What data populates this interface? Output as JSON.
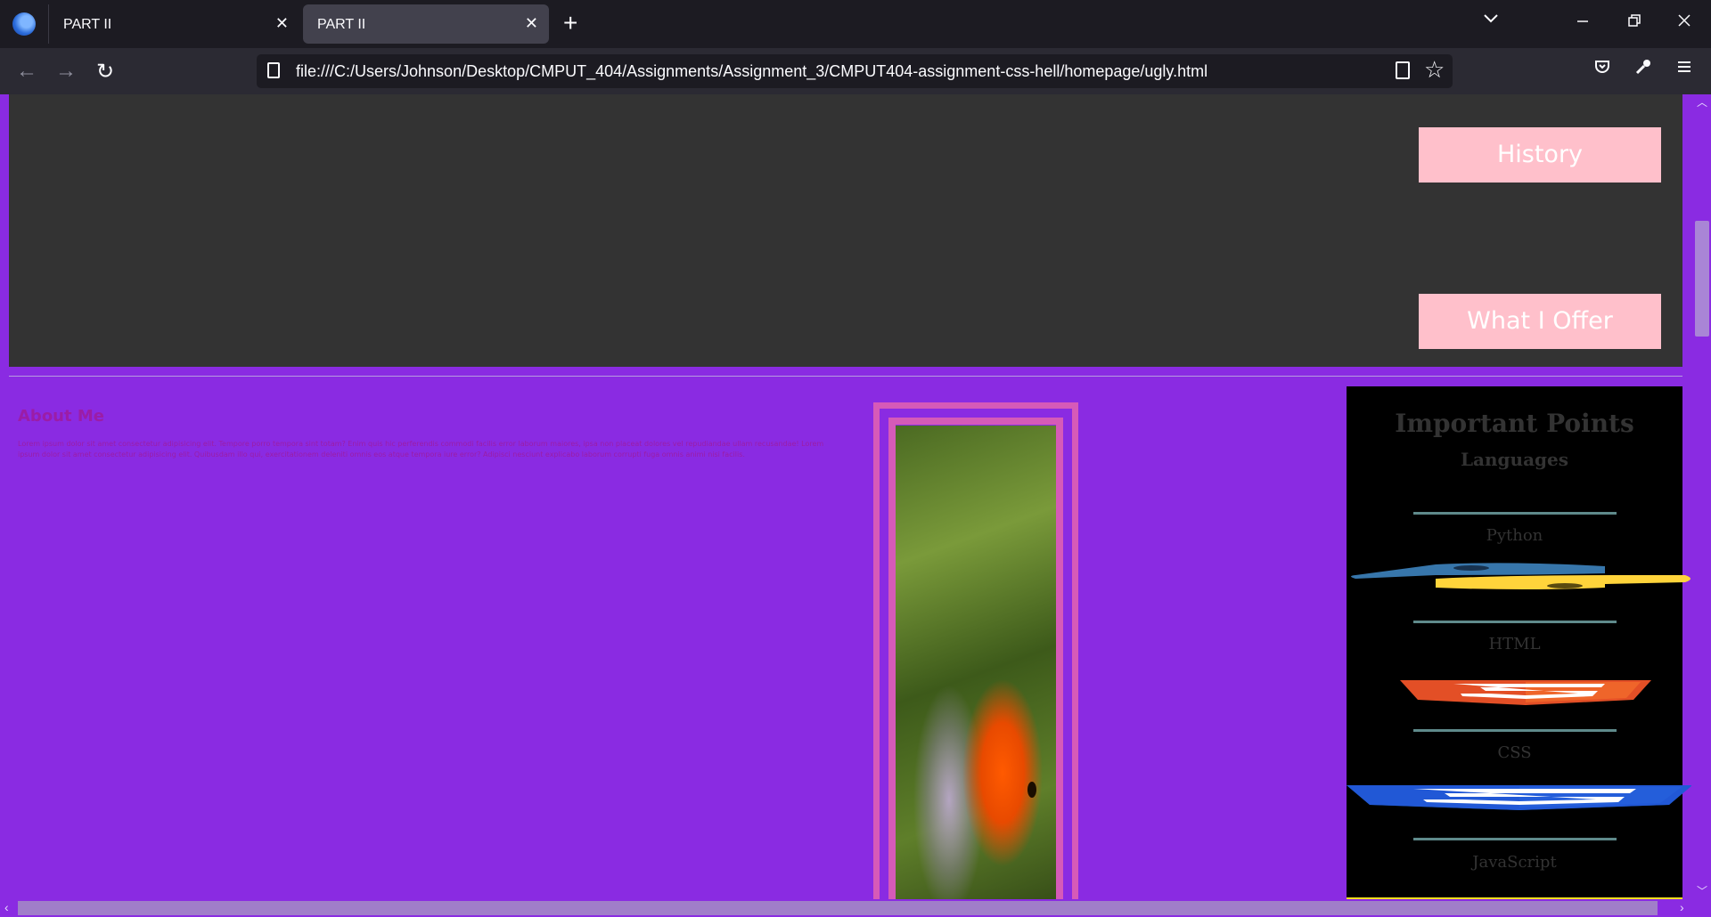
{
  "browser": {
    "tabs": [
      {
        "label": "PART II",
        "active": false
      },
      {
        "label": "PART II",
        "active": true
      }
    ],
    "new_tab_symbol": "+",
    "tab_list_symbol": "⌄",
    "window_controls": {
      "minimize": "—",
      "restore": "❐",
      "close": "✕"
    },
    "nav": {
      "back": "←",
      "forward": "→",
      "reload": "↻"
    },
    "url": "file:///C:/Users/Johnson/Desktop/CMPUT_404/Assignments/Assignment_3/CMPUT404-assignment-css-hell/homepage/ugly.html",
    "toolbar_icons": [
      "reader-view-icon",
      "bookmark-star-icon",
      "pocket-icon",
      "wrench-icon",
      "menu-icon"
    ]
  },
  "page": {
    "nav_links": [
      "History",
      "What I Offer"
    ],
    "about": {
      "title": "About Me",
      "text": "Lorem ipsum dolor sit amet consectetur adipisicing elit. Tempore porro tempora sint totam? Enim quis hic perferendis commodi facilis error laborum maiores, ipsa non placeat dolores vel repudiandae ullam recusandae! Lorem ipsum dolor sit amet consectetur adipisicing elit. Quibusdam illo qui, exercitationem deleniti omnis eos atque tempora iure error? Adipisci nesciunt explicabo laborum corrupti fuga omnis animi nisi facilis."
    },
    "image": "goldfish-photo",
    "sidebar": {
      "title": "Important Points",
      "subtitle": "Languages",
      "items": [
        "Python",
        "HTML",
        "CSS",
        "JavaScript"
      ]
    }
  },
  "colors": {
    "page_bg": "#8a2be2",
    "top_section_bg": "#333333",
    "nav_link_bg": "#ffc0cb",
    "about_text": "#9b1da6",
    "frame": "#d65ab8",
    "sidebar_bg": "#000000",
    "sidebar_text": "#333333"
  }
}
